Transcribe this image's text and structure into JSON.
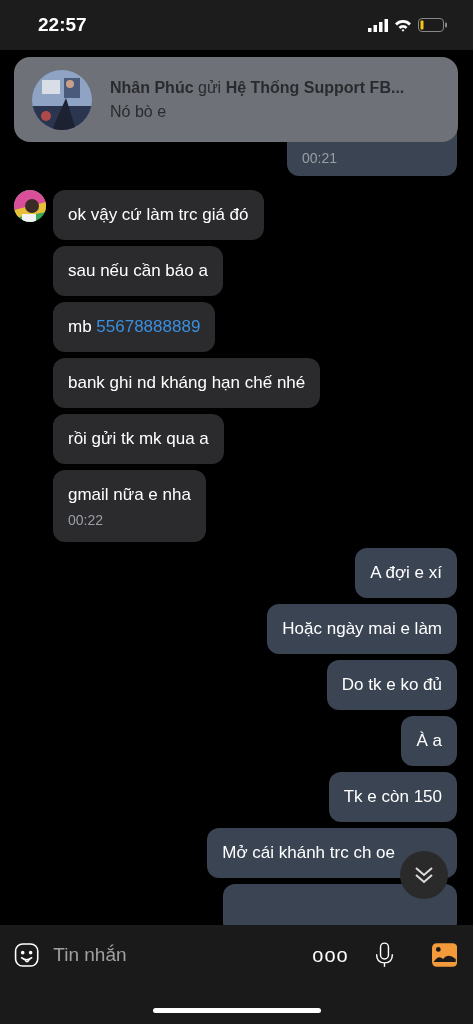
{
  "status_bar": {
    "time": "22:57"
  },
  "notification": {
    "title": "**Nhân Phúc** gửi **Hệ Thống Support FB...**",
    "body": "Nó bò e"
  },
  "messages": [
    {
      "kind": "sent",
      "time": "00:21"
    },
    {
      "kind": "received",
      "text": "ok vậy cứ làm trc giá đó",
      "avatar": true
    },
    {
      "kind": "received",
      "text": "sau nếu cần báo a"
    },
    {
      "kind": "received",
      "text": "mb ",
      "link": "55678888889"
    },
    {
      "kind": "received",
      "text": "bank ghi nd kháng hạn chế nhé"
    },
    {
      "kind": "received",
      "text": "rồi gửi tk mk qua a"
    },
    {
      "kind": "received",
      "text": "gmail nữa e nha",
      "time": "00:22"
    },
    {
      "kind": "sent",
      "text": "A đợi e xí"
    },
    {
      "kind": "sent",
      "text": "Hoặc ngày mai e làm"
    },
    {
      "kind": "sent",
      "text": "Do tk e ko đủ"
    },
    {
      "kind": "sent",
      "text": "À a"
    },
    {
      "kind": "sent",
      "text": "Tk e còn 150"
    },
    {
      "kind": "sent",
      "text": "Mở cái khánh trc ch oe"
    },
    {
      "kind": "sent"
    }
  ],
  "composer": {
    "placeholder": "Tin nhắn",
    "more": "ooo"
  }
}
